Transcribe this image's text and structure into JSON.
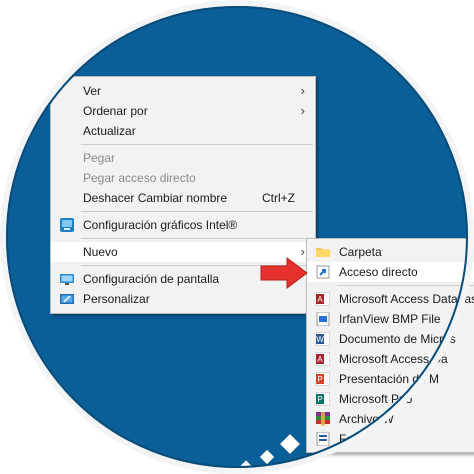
{
  "colors": {
    "desktop_blue": "#0b5f98",
    "menu_bg": "#f2f2f2",
    "highlight": "#ffffff",
    "arrow_red": "#e6312e"
  },
  "context_menu": {
    "items": [
      {
        "label": "Ver",
        "submenu": true
      },
      {
        "label": "Ordenar por",
        "submenu": true
      },
      {
        "label": "Actualizar"
      },
      {
        "label": "Pegar",
        "disabled": true
      },
      {
        "label": "Pegar acceso directo",
        "disabled": true
      },
      {
        "label": "Deshacer Cambiar nombre",
        "shortcut": "Ctrl+Z"
      },
      {
        "label": "Configuración gráficos Intel®",
        "icon": "intel-graphics-icon"
      },
      {
        "label": "Nuevo",
        "submenu": true,
        "highlighted": true
      },
      {
        "label": "Configuración de pantalla",
        "icon": "display-settings-icon"
      },
      {
        "label": "Personalizar",
        "icon": "personalize-icon"
      }
    ]
  },
  "new_submenu": {
    "items": [
      {
        "label": "Carpeta",
        "icon": "folder-icon"
      },
      {
        "label": "Acceso directo",
        "icon": "shortcut-icon",
        "highlighted": true
      },
      {
        "label": "Microsoft Access Databas",
        "icon": "access-icon"
      },
      {
        "label": "IrfanView BMP File",
        "icon": "bmp-file-icon"
      },
      {
        "label": "Documento de Micros",
        "icon": "word-icon"
      },
      {
        "label": "Microsoft Access Da",
        "icon": "access-icon"
      },
      {
        "label": "Presentación de M",
        "icon": "powerpoint-icon"
      },
      {
        "label": "Microsoft Pub",
        "icon": "publisher-icon"
      },
      {
        "label": "Archivo W",
        "icon": "winrar-icon"
      },
      {
        "label": "Fo",
        "icon": "document-icon"
      }
    ]
  }
}
